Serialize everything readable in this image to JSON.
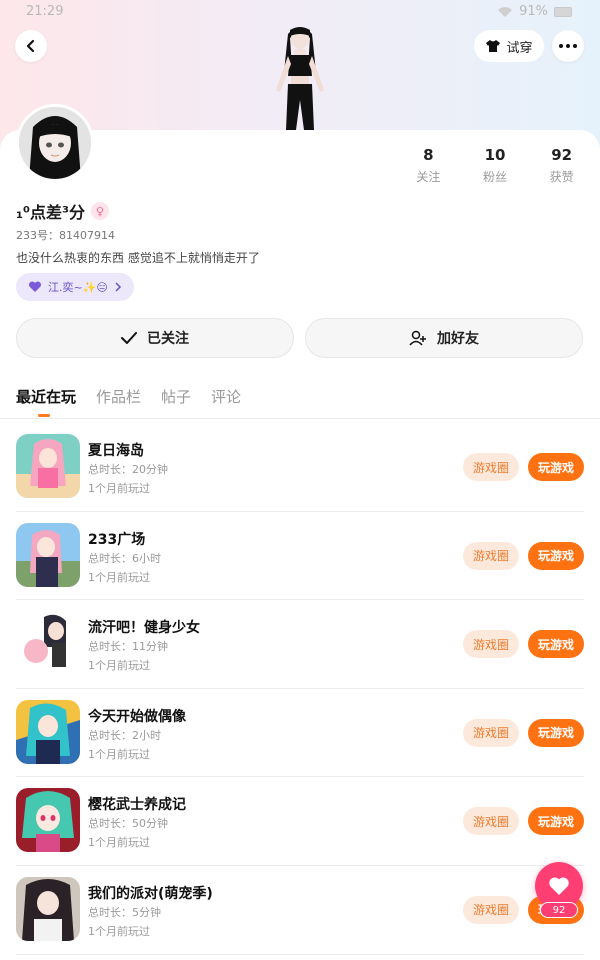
{
  "status_bar": {
    "time": "21:29",
    "battery": "91%"
  },
  "header": {
    "tryon_label": "试穿"
  },
  "profile": {
    "nickname": "₁⁰点差³分",
    "uid": "233号：81407914",
    "bio": "也没什么热衷的东西 感觉追不上就悄悄走开了",
    "tag": "江.奕~✨😑",
    "stats": [
      {
        "value": "8",
        "label": "关注"
      },
      {
        "value": "10",
        "label": "粉丝"
      },
      {
        "value": "92",
        "label": "获赞"
      }
    ]
  },
  "actions": {
    "follow_label": "已关注",
    "add_friend_label": "加好友"
  },
  "tabs": [
    "最近在玩",
    "作品栏",
    "帖子",
    "评论"
  ],
  "games": [
    {
      "title": "夏日海岛",
      "duration": "总时长：20分钟",
      "last_played": "1个月前玩过",
      "circle": "游戏圈",
      "play": "玩游戏"
    },
    {
      "title": "233广场",
      "duration": "总时长：6小时",
      "last_played": "1个月前玩过",
      "circle": "游戏圈",
      "play": "玩游戏"
    },
    {
      "title": "流汗吧！健身少女",
      "duration": "总时长：11分钟",
      "last_played": "1个月前玩过",
      "circle": "游戏圈",
      "play": "玩游戏"
    },
    {
      "title": "今天开始做偶像",
      "duration": "总时长：2小时",
      "last_played": "1个月前玩过",
      "circle": "游戏圈",
      "play": "玩游戏"
    },
    {
      "title": "樱花武士养成记",
      "duration": "总时长：50分钟",
      "last_played": "1个月前玩过",
      "circle": "游戏圈",
      "play": "玩游戏"
    },
    {
      "title": "我们的派对(萌宠季)",
      "duration": "总时长：5分钟",
      "last_played": "1个月前玩过",
      "circle": "游戏圈",
      "play": "玩游戏"
    }
  ],
  "like_fab": {
    "count": "92"
  },
  "colors": {
    "accent": "#ff7211",
    "like": "#ff3f73",
    "tag": "#6c51c9"
  }
}
